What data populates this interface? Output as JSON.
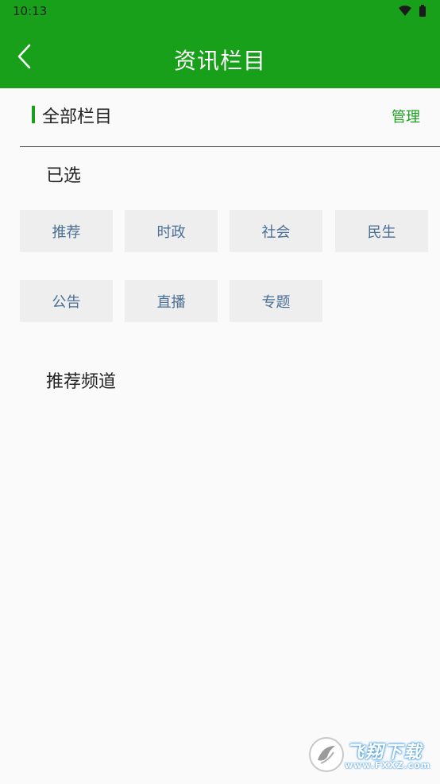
{
  "status_bar": {
    "time": "10:13",
    "icons": [
      "wifi-icon",
      "battery-icon"
    ]
  },
  "app_bar": {
    "title": "资讯栏目",
    "back_icon": "chevron-left-icon"
  },
  "section": {
    "title": "全部栏目",
    "manage_label": "管理"
  },
  "selected": {
    "label": "已选",
    "items": [
      "推荐",
      "时政",
      "社会",
      "民生",
      "公告",
      "直播",
      "专题"
    ]
  },
  "recommended": {
    "label": "推荐频道"
  },
  "watermark": {
    "text": "飞翔下载",
    "url": "www.FXXZ.com"
  },
  "colors": {
    "brand_green": "#19a01b",
    "chip_bg": "#eeeeee",
    "chip_text": "#4a6f94",
    "background": "#fafafa"
  }
}
